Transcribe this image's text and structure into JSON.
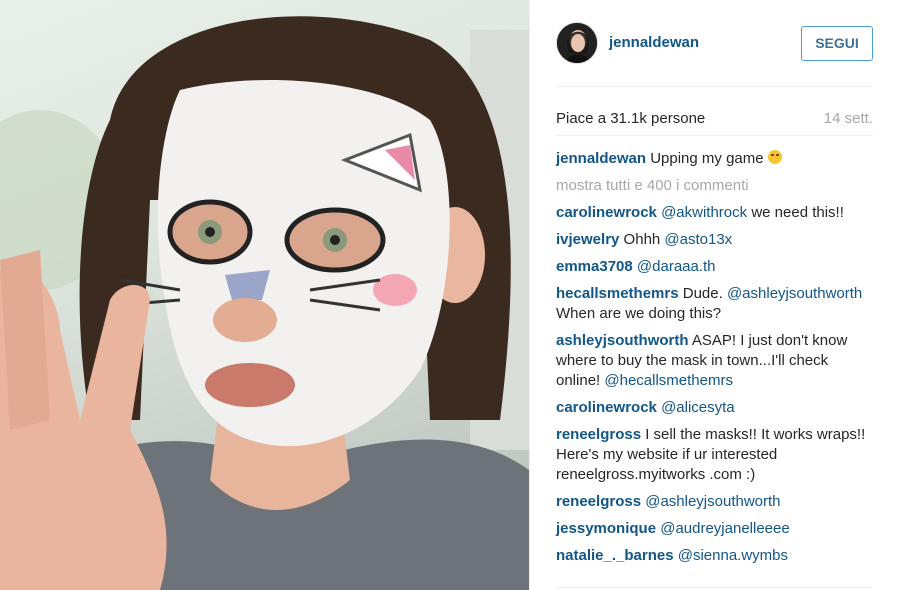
{
  "post": {
    "username": "jennaldewan",
    "follow_label": "SEGUI",
    "likes": "Piace a 31.1k persone",
    "time": "14 sett.",
    "caption_user": "jennaldewan",
    "caption_text": "Upping my game",
    "caption_emoji": "laughing-cat-emoji",
    "show_all": "mostra tutti e 400 i commenti"
  },
  "comments": [
    {
      "user": "carolinewrock",
      "mention": "@akwithrock",
      "text": " we need this!!"
    },
    {
      "user": "ivjewelry",
      "text": " Ohhh ",
      "mention": "@asto13x"
    },
    {
      "user": "emma3708",
      "mention": "@daraaa.th"
    },
    {
      "user": "hecallsmethemrs",
      "text": " Dude.",
      "mention": "@ashleyjsouthworth",
      "text2": " When are we doing this?"
    },
    {
      "user": "ashleyjsouthworth",
      "text": " ASAP! I just don't know where to buy the mask in town...I'll check online! ",
      "mention": "@hecallsmethemrs"
    },
    {
      "user": "carolinewrock",
      "mention": "@alicesyta"
    },
    {
      "user": "reneelgross",
      "text": " I sell the masks!! It works wraps!! Here's my website if ur interested reneelgross.myitworks .com :)"
    },
    {
      "user": "reneelgross",
      "mention": "@ashleyjsouthworth"
    },
    {
      "user": "jessymonique",
      "mention": "@audreyjanelleeee"
    },
    {
      "user": "natalie_._barnes",
      "mention": "@sienna.wymbs"
    }
  ],
  "colors": {
    "link": "#125688",
    "muted": "#a5a7aa",
    "follow_border": "#4c9ed9"
  }
}
